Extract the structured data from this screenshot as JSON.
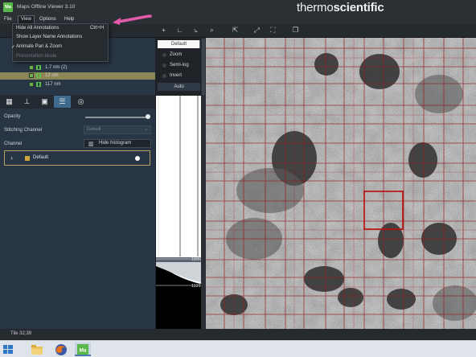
{
  "window": {
    "title": "Maps Offline Viewer 3.10",
    "app_icon_text": "Ma",
    "brand": {
      "part1": "thermo",
      "part2": "scientific"
    }
  },
  "menu": {
    "items": [
      "File",
      "View",
      "Options",
      "Help"
    ],
    "active": "View"
  },
  "view_menu": {
    "hide_all_annotations": "Hide All Annotations",
    "hide_all_shortcut": "Ctrl+H",
    "show_layer_names": "Show Layer Name Annotations",
    "animate_pan_zoom": "Animate Pan & Zoom",
    "animate_checked": true,
    "presentation_mode": "Presentation Mode"
  },
  "layers": [
    {
      "name": "1.7 nm (2)",
      "selected": false
    },
    {
      "name": "12 nm",
      "selected": true
    },
    {
      "name": "117 nm",
      "selected": false
    }
  ],
  "tabs": [
    "grid-icon",
    "align-icon",
    "image-icon",
    "sliders-icon",
    "compass-icon"
  ],
  "properties": {
    "opacity_label": "Opacity",
    "opacity_value": 1.0,
    "stitching_label": "Stitching Channel",
    "stitching_value": "Default",
    "channel_label": "Channel",
    "hide_histogram": "Hide histogram",
    "channel_name": "Default"
  },
  "histogram": {
    "preset": "Default",
    "options": [
      "Zoom",
      "Semi-log",
      "Invert"
    ],
    "auto": "Auto",
    "high_value": "18956",
    "low_value": "11216"
  },
  "status": {
    "text": "Tile 32;39"
  },
  "colors": {
    "accent": "#3e6a8e",
    "selection": "#8c8555",
    "annotation_arrow": "#e35aa9",
    "grid": "#9a1a1a"
  }
}
